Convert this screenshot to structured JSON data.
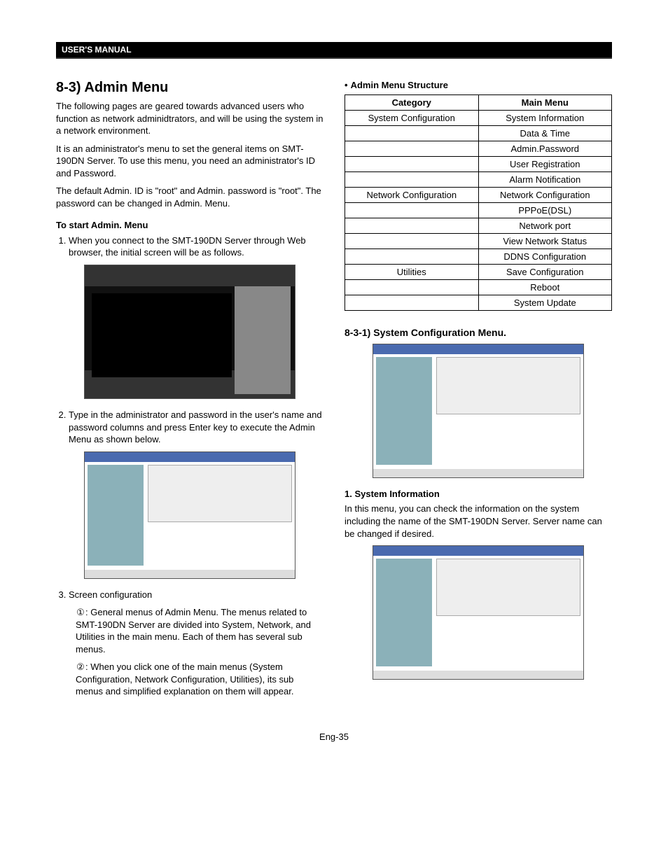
{
  "header": "USER'S MANUAL",
  "left": {
    "title": "8-3) Admin Menu",
    "intro1": "The following pages are geared towards advanced users who function as network adminidtrators, and will be using the system in a network environment.",
    "intro2": "It is an administrator's menu to set the general items on SMT-190DN Server. To use this menu, you need an administrator's ID and Password.",
    "intro3": "The default Admin. ID is \"root\" and Admin. password is \"root\". The password can be changed in Admin. Menu.",
    "start_head": "To start Admin. Menu",
    "step1": "When you connect to the SMT-190DN Server through Web browser, the initial screen will be as follows.",
    "step2": "Type in the administrator and password in the user's name and password columns and press Enter key to execute the Admin Menu as shown below.",
    "step3": "Screen configuration",
    "c1": "①",
    "c1_text": ": General menus of Admin Menu. The menus related to SMT-190DN Server are divided into System, Network, and Utilities in the main menu. Each of them has several sub menus.",
    "c2": "②",
    "c2_text": ": When you click one of the main menus (System Configuration, Network Configuration, Utilities), its sub menus and simplified explanation on them will appear."
  },
  "right": {
    "table_title": "Admin Menu Structure",
    "th_cat": "Category",
    "th_main": "Main Menu",
    "rows": [
      {
        "cat": "System Configuration",
        "menu": "System Information"
      },
      {
        "cat": "",
        "menu": "Data & Time"
      },
      {
        "cat": "",
        "menu": "Admin.Password"
      },
      {
        "cat": "",
        "menu": "User Registration"
      },
      {
        "cat": "",
        "menu": "Alarm Notification"
      },
      {
        "cat": "Network Configuration",
        "menu": "Network Configuration"
      },
      {
        "cat": "",
        "menu": "PPPoE(DSL)"
      },
      {
        "cat": "",
        "menu": "Network port"
      },
      {
        "cat": "",
        "menu": "View Network Status"
      },
      {
        "cat": "",
        "menu": "DDNS Configuration"
      },
      {
        "cat": "Utilities",
        "menu": "Save Configuration"
      },
      {
        "cat": "",
        "menu": "Reboot"
      },
      {
        "cat": "",
        "menu": "System Update"
      }
    ],
    "sec_831": "8-3-1) System Configuration Menu.",
    "sysinfo_head": "1. System Information",
    "sysinfo_text": "In this menu, you can check the information on the system including the name of the SMT-190DN Server. Server name can be changed if desired."
  },
  "page_num": "Eng-35"
}
